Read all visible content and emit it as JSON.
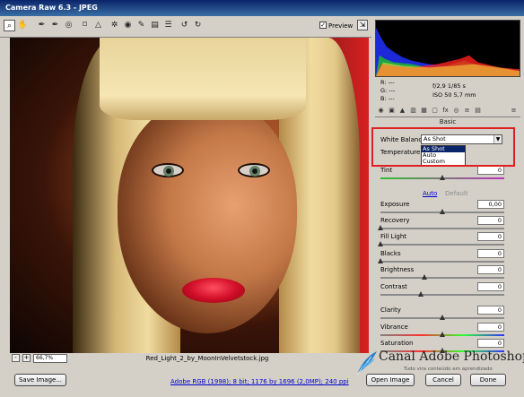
{
  "window": {
    "title": "Camera Raw 6.3  -  JPEG"
  },
  "toolbar": {
    "tools": [
      {
        "icon": "zoom-icon",
        "glyph": "🔍"
      },
      {
        "icon": "hand-icon",
        "glyph": "✋"
      },
      {
        "icon": "white-balance-icon",
        "glyph": "✒"
      },
      {
        "icon": "color-sampler-icon",
        "glyph": "✒"
      },
      {
        "icon": "targeted-adjust-icon",
        "glyph": "◎"
      },
      {
        "icon": "crop-icon",
        "glyph": "⌑"
      },
      {
        "icon": "straighten-icon",
        "glyph": "△"
      },
      {
        "icon": "spot-removal-icon",
        "glyph": "✲"
      },
      {
        "icon": "red-eye-icon",
        "glyph": "◉"
      },
      {
        "icon": "adjustment-brush-icon",
        "glyph": "✎"
      },
      {
        "icon": "graduated-filter-icon",
        "glyph": "▤"
      },
      {
        "icon": "preferences-icon",
        "glyph": "☰"
      },
      {
        "icon": "rotate-ccw-icon",
        "glyph": "↺"
      },
      {
        "icon": "rotate-cw-icon",
        "glyph": "↻"
      }
    ],
    "preview_label": "Preview",
    "preview_checked": true
  },
  "canvas": {
    "zoom": "66,7%",
    "zoom_minus": "-",
    "zoom_plus": "+",
    "filename": "Red_Light_2_by_MoonInVelvetstock.jpg"
  },
  "histogram_readout": {
    "r": "R:  ---",
    "g": "G:  ---",
    "b": "B:  ---",
    "aperture_shutter": "f/2,9   1/85 s",
    "iso_focal": "ISO 50    5,7 mm"
  },
  "panel": {
    "section_title": "Basic",
    "white_balance_label": "White Balance:",
    "white_balance_value": "As Shot",
    "white_balance_options": [
      "As Shot",
      "Auto",
      "Custom"
    ],
    "temperature_label": "Temperature",
    "auto_link": "Auto",
    "default_link": "Default",
    "sliders": [
      {
        "key": "tint",
        "label": "Tint",
        "value": "0"
      },
      {
        "key": "exposure",
        "label": "Exposure",
        "value": "0,00"
      },
      {
        "key": "recovery",
        "label": "Recovery",
        "value": "0"
      },
      {
        "key": "fill_light",
        "label": "Fill Light",
        "value": "0"
      },
      {
        "key": "blacks",
        "label": "Blacks",
        "value": "0"
      },
      {
        "key": "brightness",
        "label": "Brightness",
        "value": "0"
      },
      {
        "key": "contrast",
        "label": "Contrast",
        "value": "0"
      },
      {
        "key": "clarity",
        "label": "Clarity",
        "value": "0"
      },
      {
        "key": "vibrance",
        "label": "Vibrance",
        "value": "0"
      },
      {
        "key": "saturation",
        "label": "Saturation",
        "value": "0"
      }
    ]
  },
  "bottom": {
    "save_label": "Save Image...",
    "workflow_label": "Adobe RGB (1998); 8 bit; 1176 by 1696 (2,0MP); 240 ppi",
    "open_label": "Open Image",
    "cancel_label": "Cancel",
    "done_label": "Done"
  },
  "watermark": {
    "title": "Canal Adobe Photoshop",
    "subtitle": "Tudo vira conteúdo em aprendizado"
  }
}
